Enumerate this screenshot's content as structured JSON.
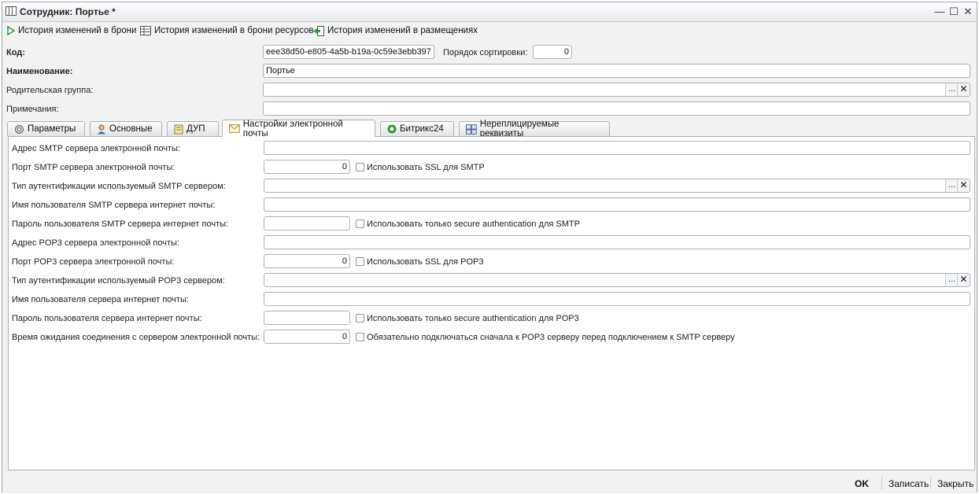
{
  "window": {
    "title": "Сотрудник: Портье *"
  },
  "toolbar": {
    "items": [
      {
        "label": "История изменений в брони"
      },
      {
        "label": "История изменений в брони ресурсов"
      },
      {
        "label": "История изменений в размещениях"
      }
    ]
  },
  "header": {
    "code_label": "Код:",
    "code_value": "eee38d50-e805-4a5b-b19a-0c59e3ebb397",
    "sort_label": "Порядок сортировки:",
    "sort_value": "0",
    "name_label": "Наименование:",
    "name_value": "Портье",
    "parent_label": "Родительская группа:",
    "parent_value": "",
    "notes_label": "Примечания:",
    "notes_value": ""
  },
  "tabs": [
    {
      "label": "Параметры"
    },
    {
      "label": "Основные"
    },
    {
      "label": "ДУП"
    },
    {
      "label": "Настройки электронной почты"
    },
    {
      "label": "Битрикс24"
    },
    {
      "label": "Нереплицируемые реквизиты"
    }
  ],
  "email": {
    "smtp_address_label": "Адрес SMTP сервера электронной почты:",
    "smtp_address_value": "",
    "smtp_port_label": "Порт SMTP сервера электронной почты:",
    "smtp_port_value": "0",
    "smtp_ssl_label": "Использовать SSL для SMTP",
    "smtp_auth_type_label": "Тип аутентификации используемый SMTP сервером:",
    "smtp_auth_type_value": "",
    "smtp_user_label": "Имя пользователя SMTP сервера интернет почты:",
    "smtp_user_value": "",
    "smtp_password_label": "Пароль пользователя SMTP сервера интернет почты:",
    "smtp_password_value": "",
    "smtp_secure_label": "Использовать только secure authentication для SMTP",
    "pop3_address_label": "Адрес POP3 сервера электронной почты:",
    "pop3_address_value": "",
    "pop3_port_label": "Порт POP3 сервера электронной почты:",
    "pop3_port_value": "0",
    "pop3_ssl_label": "Использовать SSL для POP3",
    "pop3_auth_type_label": "Тип аутентификации используемый POP3 сервером:",
    "pop3_auth_type_value": "",
    "user_label": "Имя пользователя сервера интернет почты:",
    "user_value": "",
    "password_label": "Пароль пользователя сервера интернет почты:",
    "password_value": "",
    "pop3_secure_label": "Использовать только secure authentication для POP3",
    "timeout_label": "Время ожидания соединения с сервером электронной почты:",
    "timeout_value": "0",
    "pop3_before_smtp_label": "Обязательно подключаться сначала к POP3 серверу перед подключением к SMTP серверу"
  },
  "footer": {
    "ok": "OK",
    "save": "Записать",
    "close": "Закрыть"
  },
  "field_buttons": {
    "select": "...",
    "clear": "✕"
  },
  "window_controls": {
    "minimize": "—",
    "maximize": "☐",
    "close": "✕"
  },
  "colors": {
    "accent_green": "#2e9a2e",
    "border": "#a9b2bd"
  }
}
